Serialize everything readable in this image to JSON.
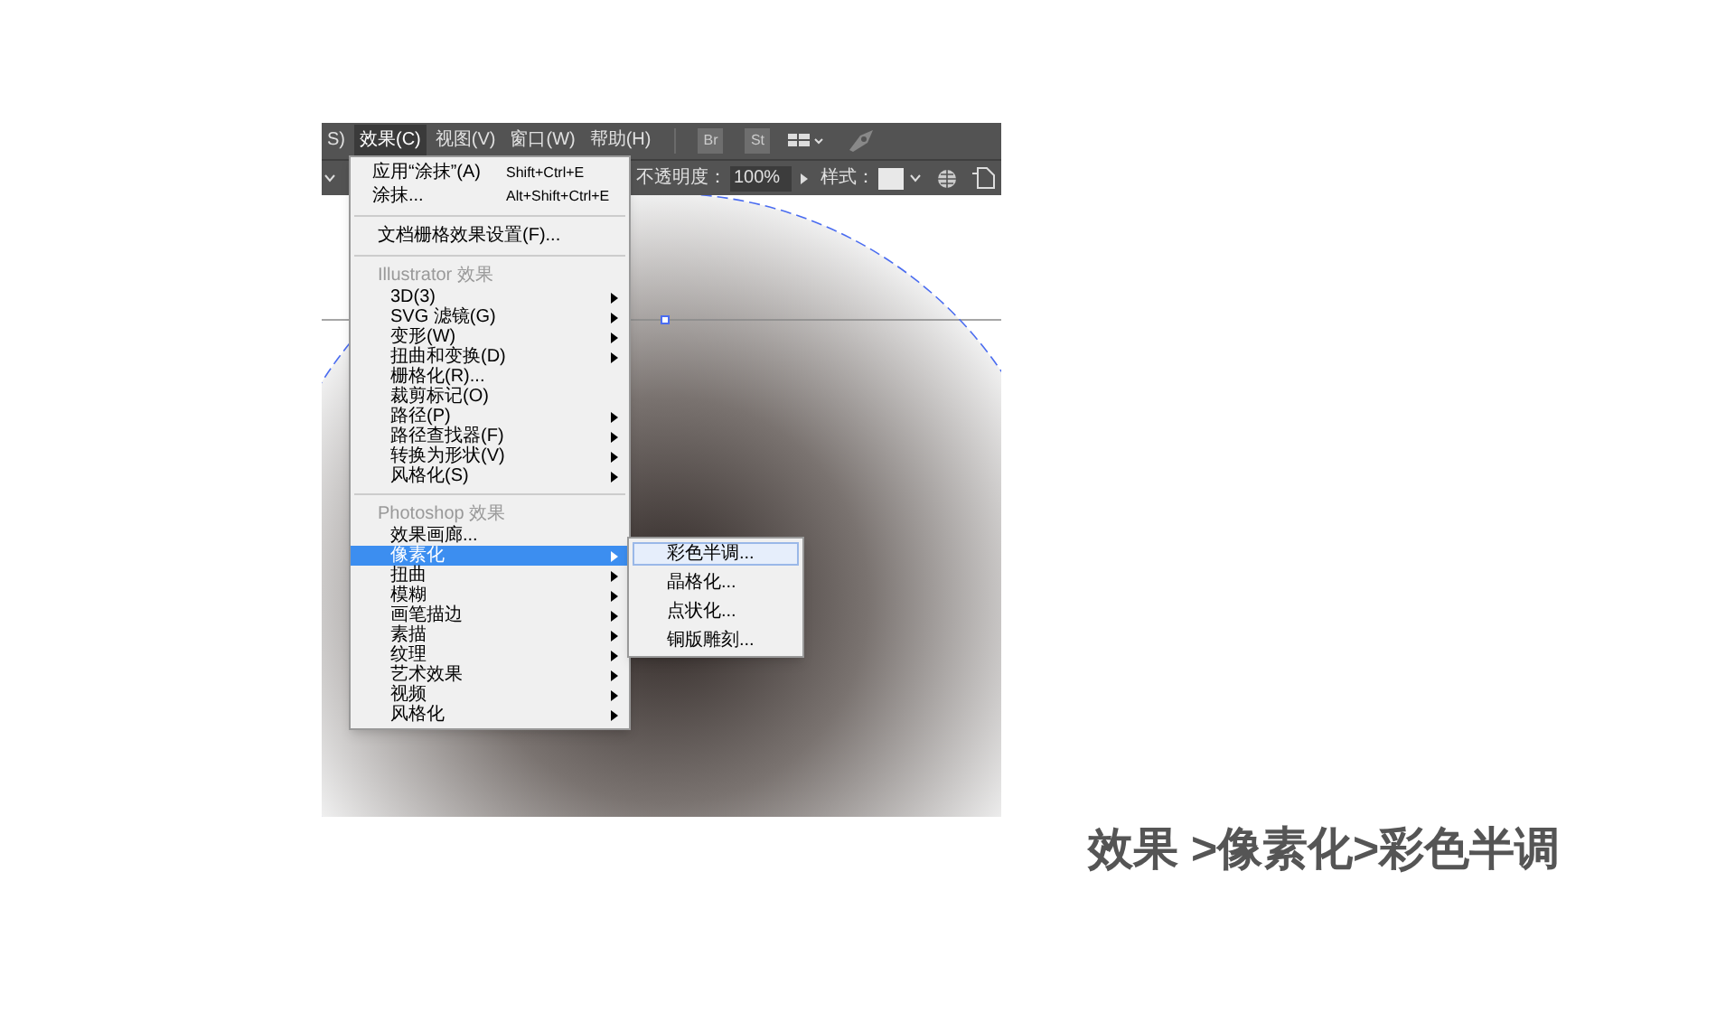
{
  "menu_bar": {
    "items": [
      {
        "label": "S)",
        "selected": false
      },
      {
        "label": "效果(C)",
        "selected": true
      },
      {
        "label": "视图(V)",
        "selected": false
      },
      {
        "label": "窗口(W)",
        "selected": false
      },
      {
        "label": "帮助(H)",
        "selected": false
      }
    ],
    "app_buttons": [
      "Br",
      "St"
    ]
  },
  "control_bar": {
    "opacity_label": "不透明度：",
    "opacity_value": "100%",
    "style_label": "样式："
  },
  "effect_menu": {
    "top_items": [
      {
        "label": "应用“涂抹”(A)",
        "shortcut": "Shift+Ctrl+E"
      },
      {
        "label": "涂抹...",
        "shortcut": "Alt+Shift+Ctrl+E"
      }
    ],
    "document_item": "文档栅格效果设置(F)...",
    "sections": [
      {
        "heading": "Illustrator 效果",
        "items": [
          {
            "label": "3D(3)",
            "submenu": true,
            "selected": false
          },
          {
            "label": "SVG 滤镜(G)",
            "submenu": true,
            "selected": false
          },
          {
            "label": "变形(W)",
            "submenu": true,
            "selected": false
          },
          {
            "label": "扭曲和变换(D)",
            "submenu": true,
            "selected": false
          },
          {
            "label": "栅格化(R)...",
            "submenu": false,
            "selected": false
          },
          {
            "label": "裁剪标记(O)",
            "submenu": false,
            "selected": false
          },
          {
            "label": "路径(P)",
            "submenu": true,
            "selected": false
          },
          {
            "label": "路径查找器(F)",
            "submenu": true,
            "selected": false
          },
          {
            "label": "转换为形状(V)",
            "submenu": true,
            "selected": false
          },
          {
            "label": "风格化(S)",
            "submenu": true,
            "selected": false
          }
        ]
      },
      {
        "heading": "Photoshop 效果",
        "items": [
          {
            "label": "效果画廊...",
            "submenu": false,
            "selected": false
          },
          {
            "label": "像素化",
            "submenu": true,
            "selected": true
          },
          {
            "label": "扭曲",
            "submenu": true,
            "selected": false
          },
          {
            "label": "模糊",
            "submenu": true,
            "selected": false
          },
          {
            "label": "画笔描边",
            "submenu": true,
            "selected": false
          },
          {
            "label": "素描",
            "submenu": true,
            "selected": false
          },
          {
            "label": "纹理",
            "submenu": true,
            "selected": false
          },
          {
            "label": "艺术效果",
            "submenu": true,
            "selected": false
          },
          {
            "label": "视频",
            "submenu": true,
            "selected": false
          },
          {
            "label": "风格化",
            "submenu": true,
            "selected": false
          }
        ]
      }
    ]
  },
  "submenu": {
    "items": [
      {
        "label": "彩色半调...",
        "selected": true
      },
      {
        "label": "晶格化...",
        "selected": false
      },
      {
        "label": "点状化...",
        "selected": false
      },
      {
        "label": "铜版雕刻...",
        "selected": false
      }
    ]
  },
  "caption": "效果 >像素化>彩色半调"
}
